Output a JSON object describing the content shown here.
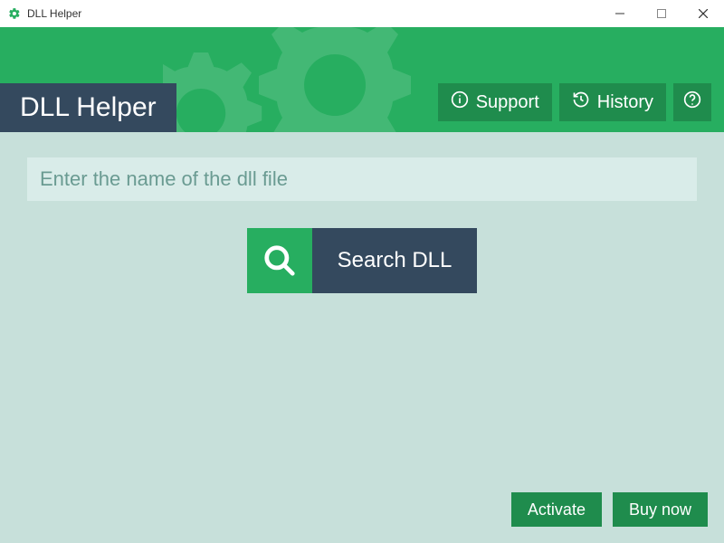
{
  "titlebar": {
    "title": "DLL Helper"
  },
  "header": {
    "app_title": "DLL Helper",
    "support_label": "Support",
    "history_label": "History"
  },
  "main": {
    "search_placeholder": "Enter the name of the dll file",
    "search_button_label": "Search DLL"
  },
  "footer": {
    "activate_label": "Activate",
    "buy_label": "Buy now"
  },
  "colors": {
    "primary": "#27ae60",
    "dark": "#34495e",
    "accent": "#1f8c4d",
    "body_bg": "#c7e0da"
  }
}
